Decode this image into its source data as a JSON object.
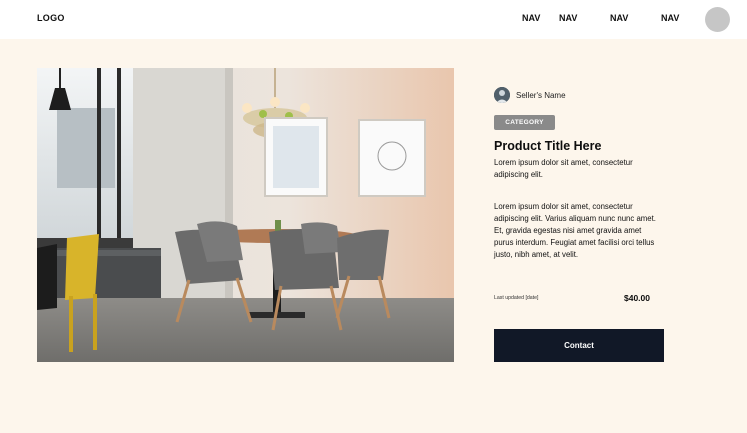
{
  "header": {
    "logo": "LOGO",
    "nav": [
      "NAV",
      "NAV",
      "NAV",
      "NAV"
    ]
  },
  "product": {
    "seller_name": "Seller's Name",
    "category": "CATEGORY",
    "title": "Product Title Here",
    "short_description": "Lorem ipsum dolor sit amet, consectetur adipiscing elit.",
    "long_description": "Lorem ipsum dolor sit amet, consectetur adipiscing elit. Varius aliquam nunc nunc amet. Et, gravida egestas nisi amet gravida amet purus interdum. Feugiat amet facilisi orci tellus justo, nibh amet, at velit.",
    "last_updated": "Last updated [date]",
    "price": "$40.00",
    "contact_label": "Contact"
  },
  "colors": {
    "page_background": "#fdf6ec",
    "header_background": "#ffffff",
    "category_badge": "#8a8a8a",
    "contact_button": "#111827"
  },
  "icons": {
    "profile": "avatar-circle",
    "seller": "seller-avatar-photo"
  }
}
